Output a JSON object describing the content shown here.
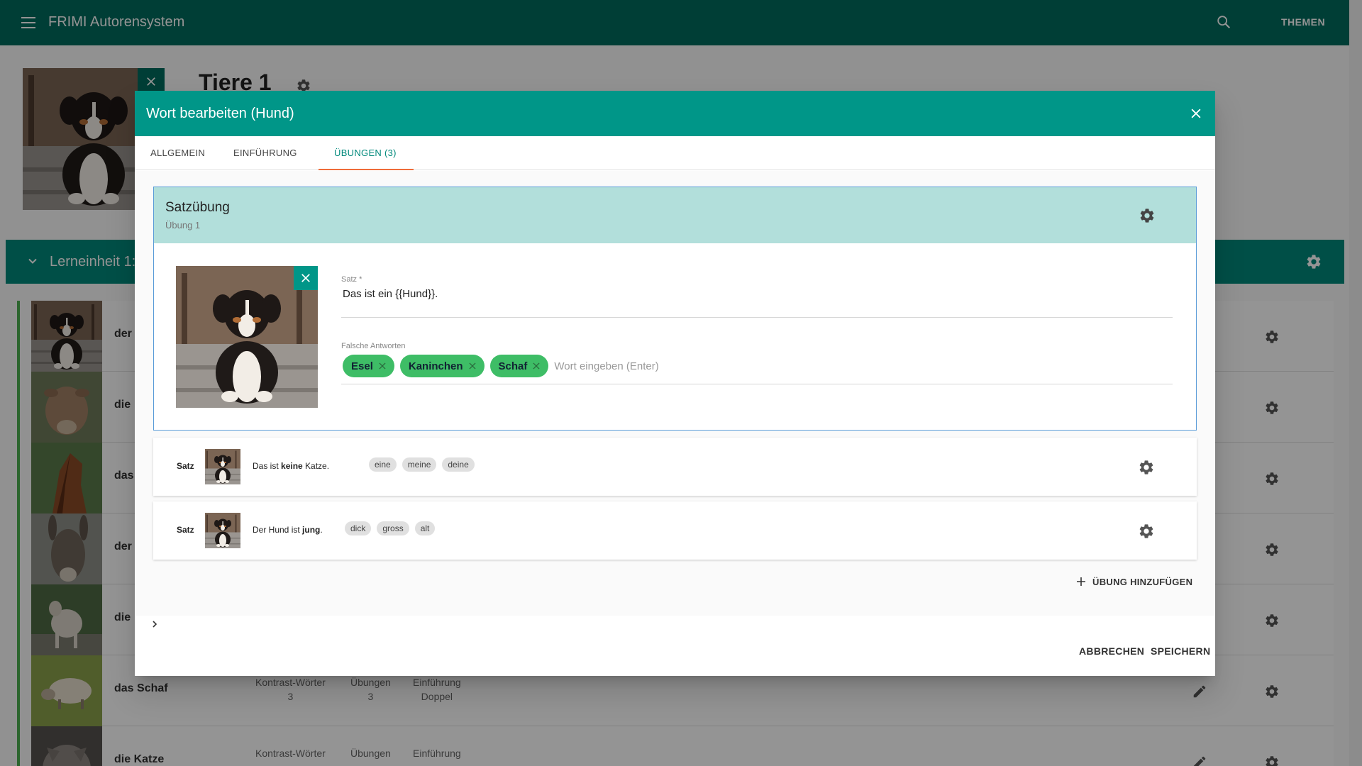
{
  "app": {
    "title": "FRIMI Autorensystem",
    "themen_label": "THEMEN",
    "menu_icon": "menu-icon",
    "search_icon": "search-icon"
  },
  "unit": {
    "title": "Tiere 1"
  },
  "lerneinheit": {
    "title": "Lerneinheit 1:"
  },
  "words": [
    {
      "name": "der",
      "photo": "dog",
      "stats": null
    },
    {
      "name": "die",
      "photo": "cow",
      "stats": null
    },
    {
      "name": "das",
      "photo": "horse",
      "stats": null
    },
    {
      "name": "der",
      "photo": "donkey",
      "stats": null
    },
    {
      "name": "die",
      "photo": "goat",
      "stats": null
    },
    {
      "name": "das Schaf",
      "photo": "sheep",
      "stats": {
        "kontrast_label": "Kontrast-Wörter",
        "kontrast_value": "3",
        "uebungen_label": "Übungen",
        "uebungen_value": "3",
        "einf_label": "Einführung",
        "einf_value": "Doppel"
      }
    },
    {
      "name": "die Katze",
      "photo": "cat",
      "stats": {
        "kontrast_label": "Kontrast-Wörter",
        "kontrast_value": "",
        "uebungen_label": "Übungen",
        "uebungen_value": "",
        "einf_label": "Einführung",
        "einf_value": ""
      }
    }
  ],
  "dialog": {
    "title": "Wort bearbeiten (Hund)",
    "tabs": [
      {
        "label": "ALLGEMEIN",
        "active": false
      },
      {
        "label": "EINFÜHRUNG",
        "active": false
      },
      {
        "label": "ÜBUNGEN (3)",
        "active": true
      }
    ],
    "active_exercise": {
      "title": "Satzübung",
      "subtitle": "Übung 1",
      "satz_label": "Satz *",
      "satz_value": "Das ist ein {{Hund}}.",
      "falsch_label": "Falsche Antworten",
      "chips": [
        "Esel",
        "Kaninchen",
        "Schaf"
      ],
      "chip_placeholder": "Wort eingeben (Enter)"
    },
    "collapsed_exercises": [
      {
        "type": "Satz",
        "sentence_pre": "Das ist ",
        "sentence_bold": "keine",
        "sentence_post": " Katze.",
        "tags": [
          "eine",
          "meine",
          "deine"
        ]
      },
      {
        "type": "Satz",
        "sentence_pre": "Der Hund ist ",
        "sentence_bold": "jung",
        "sentence_post": ".",
        "tags": [
          "dick",
          "gross",
          "alt"
        ]
      }
    ],
    "add_label": "ÜBUNG HINZUFÜGEN",
    "cancel_label": "ABBRECHEN",
    "save_label": "SPEICHERN"
  },
  "colors": {
    "appbar": "#006b5e",
    "dialog_header": "#009688",
    "exercise_header": "#b2dfdb",
    "chip": "#3ebd66",
    "tab_indicator": "#ef6c3a",
    "active_border": "#5a9bd8"
  }
}
